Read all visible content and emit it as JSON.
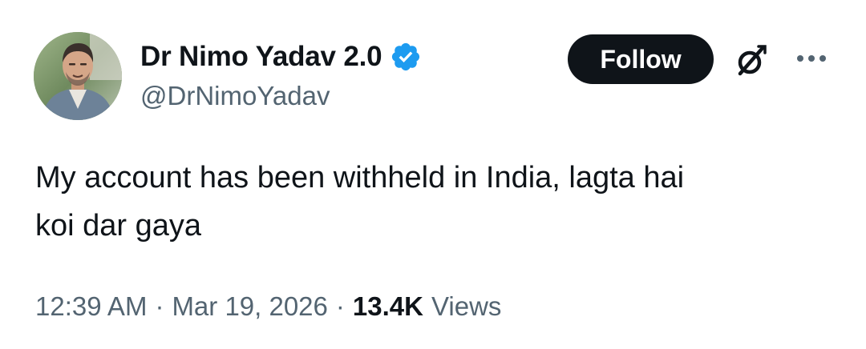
{
  "author": {
    "display_name": "Dr Nimo Yadav 2.0",
    "handle": "@DrNimoYadav",
    "verified": true,
    "badge_color": "#1d9bf0"
  },
  "actions": {
    "follow_label": "Follow",
    "grok_icon": "grok-icon",
    "more_icon": "more-horizontal-icon"
  },
  "tweet": {
    "text_line1": "My account has been withheld in India, lagta hai",
    "text_line2": "koi dar gaya"
  },
  "meta": {
    "time": "12:39 AM",
    "separator": "·",
    "date": "Mar 19, 2026",
    "views_count": "13.4K",
    "views_label": "Views"
  }
}
